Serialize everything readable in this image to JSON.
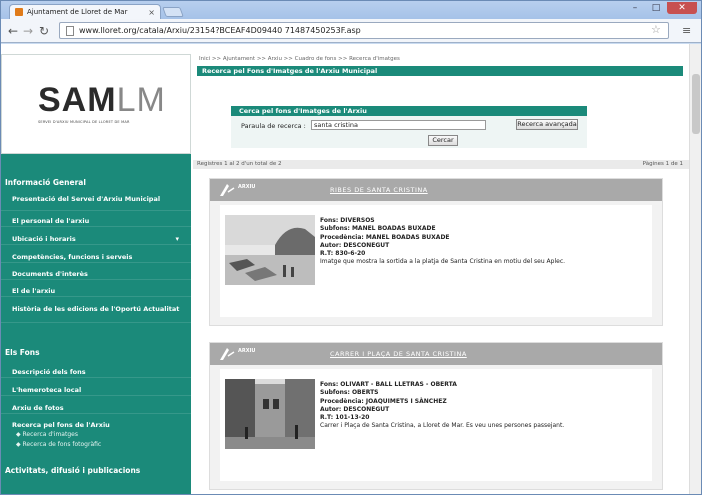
{
  "browser": {
    "tab_title": "Ajuntament de Lloret de Mar",
    "url": "www.lloret.org/catala/Arxiu/23154?BCEAF4D09440 71487450253F.asp"
  },
  "sidebar": {
    "logo_main": "SAM",
    "logo_secondary": "LM",
    "logo_subtitle": "SERVEI D'ARXIU MUNICIPAL DE LLORET DE MAR",
    "section_general": "Informació General",
    "general_items": [
      "Presentació del Servei d'Arxiu Municipal",
      "El personal de l'arxiu",
      "Ubicació i horaris",
      "Competències, funcions i serveis",
      "Documents d'interès",
      "El de l'arxiu",
      "Història de les edicions de l'Oportú Actualitat"
    ],
    "section_fons": "Els Fons",
    "fons_items": [
      "Descripció dels fons",
      "L'hemeroteca local",
      "Arxiu de fotos",
      "Recerca pel fons de l'Arxiu"
    ],
    "fons_subitems": [
      "Recerca d'imatges",
      "Recerca de fons fotogràfic"
    ],
    "section_bottom": "Activitats, difusió i publicacions"
  },
  "content": {
    "breadcrumb": "Inici >> Ajuntament >> Arxiu >> Cuadro de fons >> Recerca d'imatges",
    "page_title": "Recerca pel Fons d'Imatges de l'Arxiu Municipal",
    "search": {
      "heading": "Cerca pel fons d'Imatges de l'Arxiu",
      "label": "Paraula de recerca :",
      "value": "santa cristina",
      "advanced_label": "Recerca avançada",
      "search_label": "Cercar"
    },
    "results": {
      "summary": "Registres 1 al 2 d'un total de 2",
      "pages": "Pàgines 1 de 1"
    },
    "cards": [
      {
        "mark_label": "ARXIU",
        "title": "RIBES DE SANTA CRISTINA",
        "fons": "Fons: DIVERSOS",
        "subfons": "Subfons: MANEL BOADAS BUXADE",
        "procedencia": "Procedència: MANEL BOADAS BUXADE",
        "autor": "Autor: DESCONEGUT",
        "ref": "R.T: 830-6-20",
        "desc": "Imatge que mostra la sortida a la platja de Santa Cristina en motiu del seu Aplec."
      },
      {
        "mark_label": "ARXIU",
        "title": "CARRER I PLAÇA DE SANTA CRISTINA",
        "fons": "Fons: OLIVART - BALL LLETRAS - OBERTA",
        "subfons": "Subfons: OBERTS",
        "procedencia": "Procedència: JOAQUIMETS I SÀNCHEZ",
        "autor": "Autor: DESCONEGUT",
        "ref": "R.T: 101-13-20",
        "desc": "Carrer i Plaça de Santa Cristina, a Lloret de Mar. Es veu unes persones passejant."
      }
    ]
  }
}
